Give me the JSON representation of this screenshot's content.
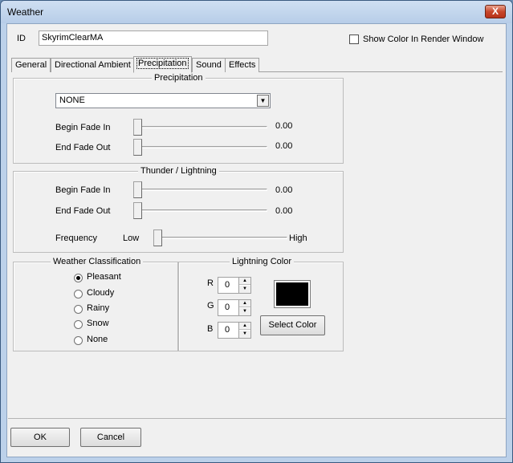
{
  "window": {
    "title": "Weather",
    "close_glyph": "X"
  },
  "id_field": {
    "label": "ID",
    "value": "SkyrimClearMA"
  },
  "render_checkbox": {
    "label": "Show Color In Render Window",
    "checked": false
  },
  "tabs": [
    {
      "label": "General",
      "active": false
    },
    {
      "label": "Directional Ambient",
      "active": false
    },
    {
      "label": "Precipitation",
      "active": true
    },
    {
      "label": "Sound",
      "active": false
    },
    {
      "label": "Effects",
      "active": false
    }
  ],
  "precipitation": {
    "title": "Precipitation",
    "type_value": "NONE",
    "begin_fade_in": {
      "label": "Begin Fade In",
      "value": "0.00",
      "level": 0
    },
    "end_fade_out": {
      "label": "End Fade Out",
      "value": "0.00",
      "level": 0
    }
  },
  "thunder": {
    "title": "Thunder / Lightning",
    "begin_fade_in": {
      "label": "Begin Fade In",
      "value": "0.00",
      "level": 0
    },
    "end_fade_out": {
      "label": "End Fade Out",
      "value": "0.00",
      "level": 0
    },
    "frequency": {
      "label": "Frequency",
      "low_label": "Low",
      "high_label": "High",
      "level": 0
    }
  },
  "classification": {
    "title": "Weather Classification",
    "options": [
      "Pleasant",
      "Cloudy",
      "Rainy",
      "Snow",
      "None"
    ],
    "selected": "Pleasant"
  },
  "lightning_color": {
    "title": "Lightning Color",
    "r": {
      "label": "R",
      "value": "0"
    },
    "g": {
      "label": "G",
      "value": "0"
    },
    "b": {
      "label": "B",
      "value": "0"
    },
    "swatch_color": "#000000",
    "select_button": "Select Color"
  },
  "footer": {
    "ok_label": "OK",
    "cancel_label": "Cancel"
  },
  "icons": {
    "dropdown": "dropdown-arrow-icon",
    "spin_up": "spin-up-icon",
    "spin_down": "spin-down-icon"
  }
}
